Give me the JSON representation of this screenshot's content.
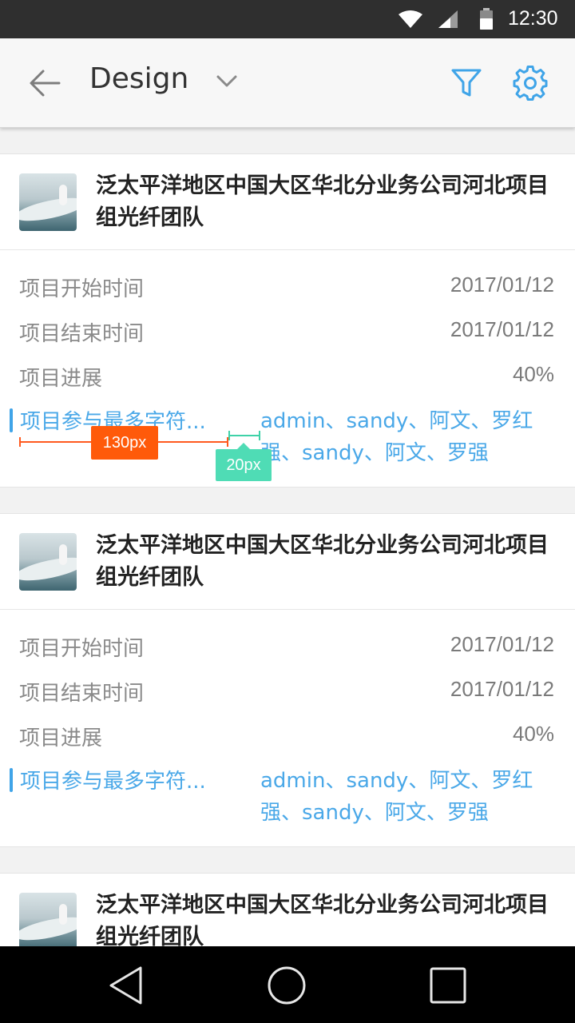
{
  "status_bar": {
    "time": "12:30"
  },
  "app_bar": {
    "title": "Design"
  },
  "labels": {
    "start": "项目开始时间",
    "end": "项目结束时间",
    "progress": "项目进展",
    "participants": "项目参与最多字符..."
  },
  "cards": [
    {
      "title": "泛太平洋地区中国大区华北分业务公司河北项目组光纤团队",
      "start_date": "2017/01/12",
      "end_date": "2017/01/12",
      "progress": "40%",
      "participants": "admin、sandy、阿文、罗红强、sandy、阿文、罗强"
    },
    {
      "title": "泛太平洋地区中国大区华北分业务公司河北项目组光纤团队",
      "start_date": "2017/01/12",
      "end_date": "2017/01/12",
      "progress": "40%",
      "participants": "admin、sandy、阿文、罗红强、sandy、阿文、罗强"
    },
    {
      "title": "泛太平洋地区中国大区华北分业务公司河北项目组光纤团队"
    }
  ],
  "annotations": {
    "width_label": "130px",
    "gap_label": "20px"
  },
  "colors": {
    "accent": "#3fa4e8",
    "measure": "#ff5a0a",
    "gap": "#4fdcb5"
  }
}
